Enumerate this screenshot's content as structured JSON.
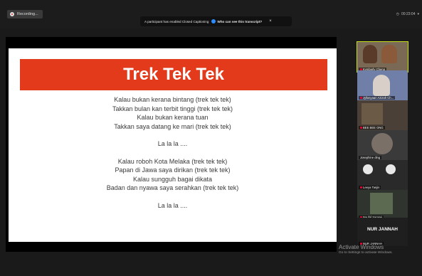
{
  "recording": {
    "label": "Recording..."
  },
  "banner": {
    "message": "A participant has enabled Closed Captioning",
    "link": "Who can see this transcript?",
    "close": "×"
  },
  "timer": {
    "value": "00:23:04"
  },
  "slide": {
    "title": "Trek Tek Tek",
    "verse1": [
      "Kalau bukan kerana bintang (trek tek tek)",
      "Takkan bulan kan terbit tinggi (trek tek tek)",
      "Kalau bukan kerana tuan",
      "Takkan saya datang ke mari (trek tek tek)"
    ],
    "chorus1": "La la la ....",
    "verse2": [
      "Kalau roboh Kota Melaka (trek tek tek)",
      "Papan di Jawa saya dirikan (trek tek tek)",
      "Kalau sungguh bagai dikata",
      "Badan dan nyawa saya serahkan (trek tek tek)"
    ],
    "chorus2": "La la la ...."
  },
  "participants": [
    {
      "name": "Kymberly Cheng",
      "muted": true
    },
    {
      "name": "Jyllasyaan Azizah Ch...",
      "muted": true
    },
    {
      "name": "BEE BEE ONG",
      "muted": true
    },
    {
      "name": "Josephine ding",
      "muted": false
    },
    {
      "name": "Leeya Tanjin",
      "muted": true
    },
    {
      "name": "Naufal Samsei",
      "muted": true
    },
    {
      "name": "NUR JANNAH",
      "muted": true,
      "label": "NUR JANNAH"
    }
  ],
  "watermark": {
    "title": "Activate Windows",
    "subtitle": "Go to Settings to activate Windows."
  }
}
